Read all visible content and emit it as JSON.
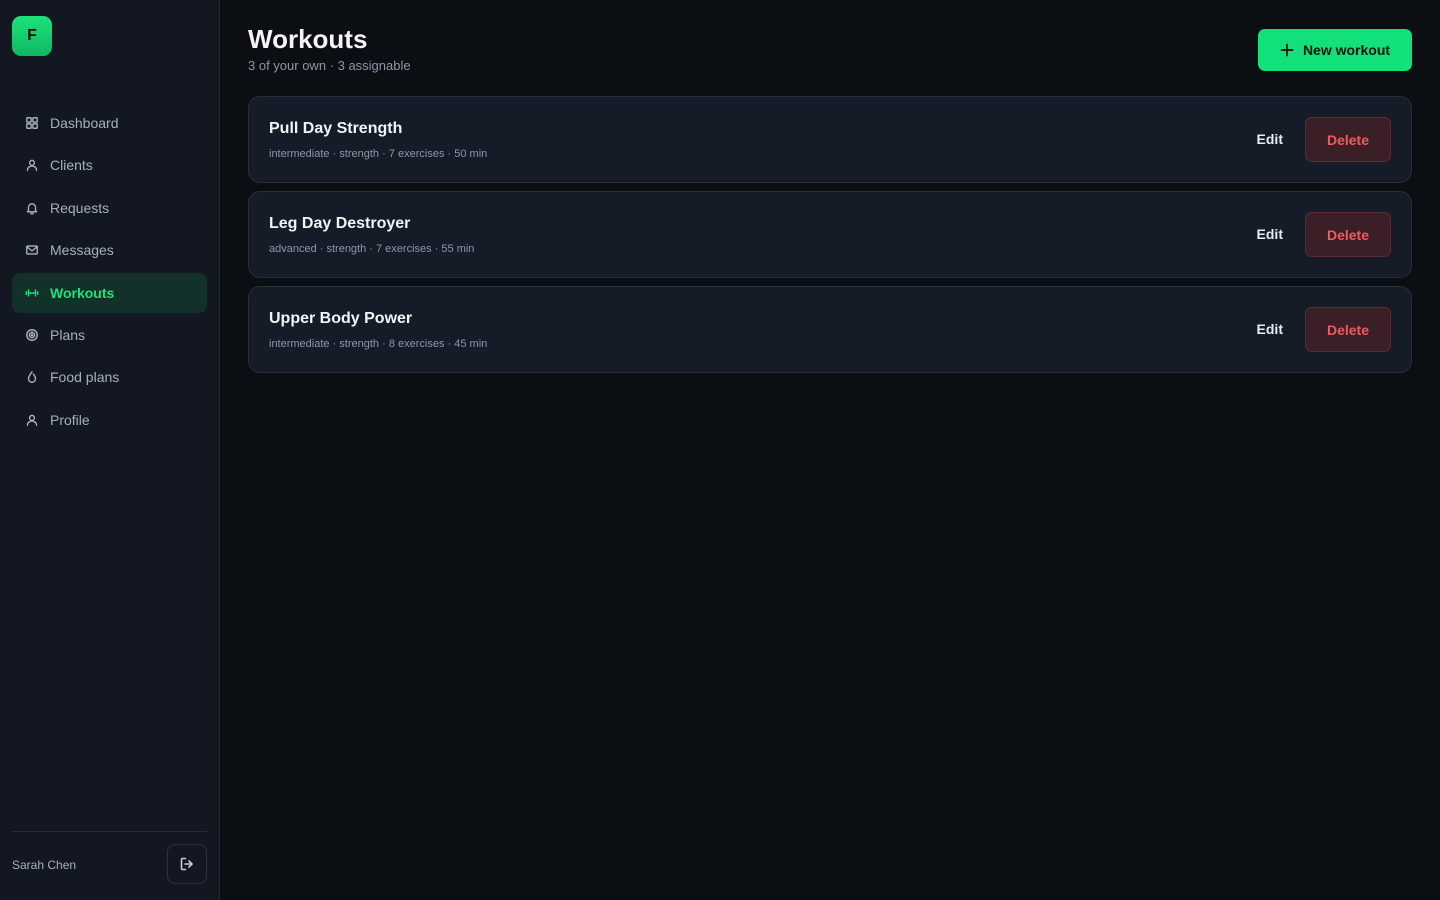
{
  "app": {
    "logo_letter": "F",
    "accent": "#12e07a"
  },
  "sidebar": {
    "items": [
      {
        "label": "Dashboard",
        "icon": "grid-icon",
        "active": false
      },
      {
        "label": "Clients",
        "icon": "user-icon",
        "active": false
      },
      {
        "label": "Requests",
        "icon": "bell-icon",
        "active": false
      },
      {
        "label": "Messages",
        "icon": "mail-icon",
        "active": false
      },
      {
        "label": "Workouts",
        "icon": "dumbbell-icon",
        "active": true
      },
      {
        "label": "Plans",
        "icon": "target-icon",
        "active": false
      },
      {
        "label": "Food plans",
        "icon": "drop-icon",
        "active": false
      },
      {
        "label": "Profile",
        "icon": "user-icon",
        "active": false
      }
    ],
    "user_name": "Sarah Chen",
    "logout_icon": "logout-icon"
  },
  "header": {
    "title": "Workouts",
    "subtitle": "3 of your own · 3 assignable",
    "new_button_label": "New workout"
  },
  "workouts": [
    {
      "title": "Pull Day Strength",
      "meta": "intermediate · strength · 7 exercises · 50 min",
      "edit_label": "Edit",
      "delete_label": "Delete"
    },
    {
      "title": "Leg Day Destroyer",
      "meta": "advanced · strength · 7 exercises · 55 min",
      "edit_label": "Edit",
      "delete_label": "Delete"
    },
    {
      "title": "Upper Body Power",
      "meta": "intermediate · strength · 8 exercises · 45 min",
      "edit_label": "Edit",
      "delete_label": "Delete"
    }
  ]
}
